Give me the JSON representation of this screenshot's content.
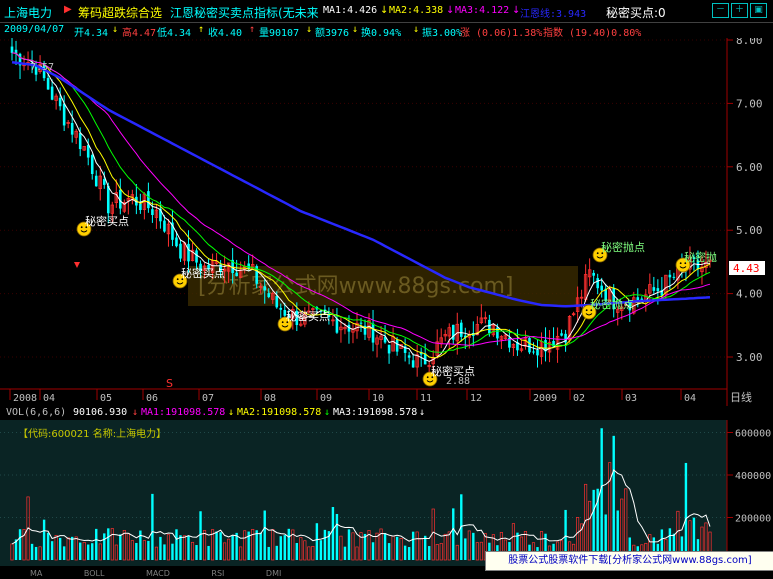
{
  "header": {
    "stock_name": "上海电力",
    "formula_name": "筹码超跌综合选",
    "indicator_title": "江恩秘密买卖点指标(无未来",
    "ma1": "MA1:4.426",
    "ma2": "MA2:4.338",
    "ma3": "MA3:4.122",
    "extra_label": "江恩线:3.943",
    "secret_buy": "秘密买点:0"
  },
  "info": {
    "date": "2009/04/07",
    "open": "开4.34",
    "high": "高4.47",
    "low": "低4.34",
    "close": "收4.40",
    "volume": "量90107",
    "amount": "额3976",
    "turnover": "换0.94%",
    "amplitude": "振3.00%",
    "change": "涨 (0.06)1.38%",
    "index": "指数 (19.40)0.80%"
  },
  "price_axis": [
    "8.00",
    "7.00",
    "6.00",
    "5.00",
    "4.00",
    "3.00"
  ],
  "current_price_tag": "4.43",
  "price_axis_label_left": "7.57",
  "low_label": "2.88",
  "time_axis": [
    "2008",
    "04",
    "05",
    "06",
    "07",
    "08",
    "09",
    "10",
    "11",
    "12",
    "2009",
    "02",
    "03",
    "04"
  ],
  "time_axis_mode": "日线",
  "watermark": "[分析家公式网www.88gs.com]",
  "signals": [
    {
      "label": "秘密买点"
    },
    {
      "label": "秘密买点"
    },
    {
      "label": "秘密买点"
    },
    {
      "label": "秘密买点"
    },
    {
      "label": "秘密抛点"
    },
    {
      "label": "秘密抛点"
    },
    {
      "label": "秘密抛"
    }
  ],
  "s_marker": "S",
  "vol": {
    "title": "VOL(6,6,6)",
    "value": "90106.930",
    "ma1": "MA1:191098.578",
    "ma2": "MA2:191098.578",
    "ma3": "MA3:191098.578",
    "code_label": "【代码:600021 名称:上海电力】",
    "axis": [
      "600000",
      "400000",
      "200000"
    ]
  },
  "tabs": [
    "MA",
    "BOLL",
    "MACD",
    "RSI",
    "DMI"
  ],
  "banner": "股票公式股票软件下载[分析家公式网www.88gs.com]",
  "icons": [
    "minus-icon",
    "plus-icon",
    "restore-icon"
  ],
  "chart_data": {
    "type": "line",
    "title": "",
    "xlabel": "",
    "ylabel": "",
    "ylim": [
      2.6,
      8.3
    ],
    "series": [
      {
        "name": "MA1",
        "values": [
          7.8,
          7.6,
          6.9,
          6.3,
          5.4,
          5.5,
          5.3,
          4.7,
          4.4,
          4.5,
          4.3,
          3.8,
          3.6,
          3.6,
          3.5,
          3.4,
          3.1,
          2.9,
          3.3,
          3.5,
          3.5,
          3.2,
          3.2,
          3.4,
          4.3,
          3.9,
          3.9,
          4.1,
          4.4,
          4.43
        ]
      },
      {
        "name": "MA3",
        "values": [
          7.65,
          7.6,
          7.4,
          7.15,
          6.9,
          6.7,
          6.5,
          6.3,
          6.1,
          5.9,
          5.7,
          5.5,
          5.3,
          5.15,
          5.0,
          4.85,
          4.65,
          4.45,
          4.25,
          4.1,
          4.0,
          3.9,
          3.82,
          3.8,
          3.82,
          3.85,
          3.88,
          3.9,
          3.92,
          3.943
        ]
      }
    ]
  }
}
